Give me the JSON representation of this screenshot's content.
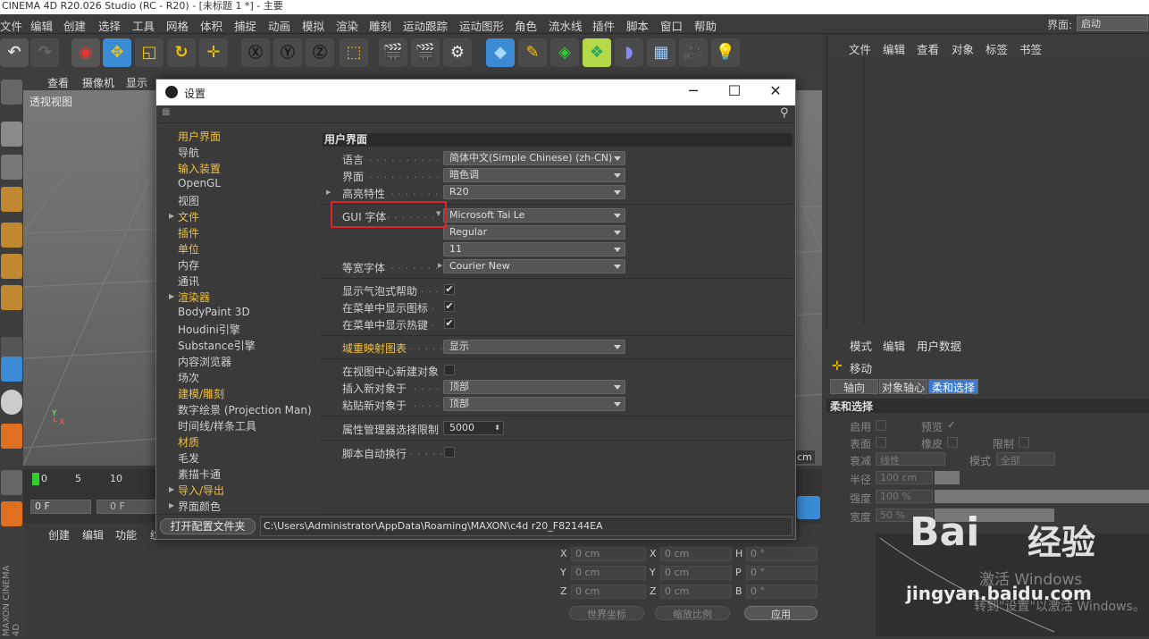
{
  "title_bar": "CINEMA 4D R20.026 Studio (RC - R20) - [未标题 1 *] - 主要",
  "menu": [
    "文件",
    "编辑",
    "创建",
    "选择",
    "工具",
    "网格",
    "体积",
    "捕捉",
    "动画",
    "模拟",
    "渲染",
    "雕刻",
    "运动跟踪",
    "运动图形",
    "角色",
    "流水线",
    "插件",
    "脚本",
    "窗口",
    "帮助"
  ],
  "layout": {
    "label": "界面:",
    "value": "启动"
  },
  "viewport": {
    "menu": [
      "查看",
      "摄像机",
      "显示"
    ],
    "name": "透视视图",
    "unit": "cm"
  },
  "timeline": {
    "ticks": [
      "0",
      "5",
      "10"
    ],
    "frame_a": "0 F",
    "frame_b": "0 F"
  },
  "bottom_menu": [
    "创建",
    "编辑",
    "功能",
    "纹"
  ],
  "coords": {
    "rows": [
      {
        "a": "X",
        "av": "0 cm",
        "b": "X",
        "bv": "0 cm",
        "c": "H",
        "cv": "0 °"
      },
      {
        "a": "Y",
        "av": "0 cm",
        "b": "Y",
        "bv": "0 cm",
        "c": "P",
        "cv": "0 °"
      },
      {
        "a": "Z",
        "av": "0 cm",
        "b": "Z",
        "bv": "0 cm",
        "c": "B",
        "cv": "0 °"
      }
    ],
    "world": "世界坐标",
    "scale": "缩放比例",
    "apply": "应用"
  },
  "object_manager": {
    "menu": [
      "文件",
      "编辑",
      "查看",
      "对象",
      "标签",
      "书签"
    ]
  },
  "attr_manager": {
    "menu": [
      "模式",
      "编辑",
      "用户数据"
    ],
    "tool": "移动",
    "tabs": [
      "轴向",
      "对象轴心",
      "柔和选择"
    ],
    "section": "柔和选择",
    "rows": {
      "enable": "启用",
      "preview": "预览",
      "surface": "表面",
      "rubber": "橡皮",
      "limit": "限制",
      "falloff": "衰减",
      "falloff_val": "线性",
      "mode": "模式",
      "mode_val": "全部",
      "radius": "半径",
      "radius_val": "100 cm",
      "strength": "强度",
      "strength_val": "100 %",
      "width": "宽度",
      "width_val": "50 %"
    }
  },
  "dialog": {
    "title": "设置",
    "nav": [
      "用户界面",
      "导航",
      "输入装置",
      "OpenGL",
      "视图",
      "文件",
      "插件",
      "单位",
      "内存",
      "通讯",
      "渲染器",
      "BodyPaint 3D",
      "Houdini引擎",
      "Substance引擎",
      "内容浏览器",
      "场次",
      "建模/雕刻",
      "数字绘景 (Projection Man)",
      "时间线/样条工具",
      "材质",
      "毛发",
      "素描卡通",
      "导入/导出",
      "界面颜色"
    ],
    "section": "用户界面",
    "language": {
      "label": "语言",
      "value": "简体中文(Simple Chinese) (zh-CN)"
    },
    "scheme": {
      "label": "界面",
      "value": "暗色调"
    },
    "highlight": {
      "label": "高亮特性",
      "value": "R20"
    },
    "gui_font": {
      "label": "GUI 字体",
      "value": "Microsoft Tai Le",
      "style": "Regular",
      "size": "11"
    },
    "mono_font": {
      "label": "等宽字体",
      "value": "Courier New"
    },
    "bubble": {
      "label": "显示气泡式帮助",
      "checked": "✔"
    },
    "menu_icons": {
      "label": "在菜单中显示图标",
      "checked": "✔"
    },
    "menu_hotkeys": {
      "label": "在菜单中显示热键",
      "checked": "✔"
    },
    "field_map": {
      "label": "域重映射图表",
      "value": "显示"
    },
    "new_obj_center": {
      "label": "在视图中心新建对象"
    },
    "insert_new": {
      "label": "插入新对象于",
      "value": "顶部"
    },
    "paste_new": {
      "label": "粘贴新对象于",
      "value": "顶部"
    },
    "attr_limit": {
      "label": "属性管理器选择限制",
      "value": "5000"
    },
    "script_wrap": {
      "label": "脚本自动换行"
    },
    "open_folder": "打开配置文件夹",
    "path": "C:\\Users\\Administrator\\AppData\\Roaming\\MAXON\\c4d r20_F82144EA"
  },
  "watermark": {
    "brand": "Bai",
    "brand2": "经验",
    "url": "jingyan.baidu.com",
    "activate": "激活 Windows",
    "activate_sub": "转到\"设置\"以激活 Windows。"
  }
}
